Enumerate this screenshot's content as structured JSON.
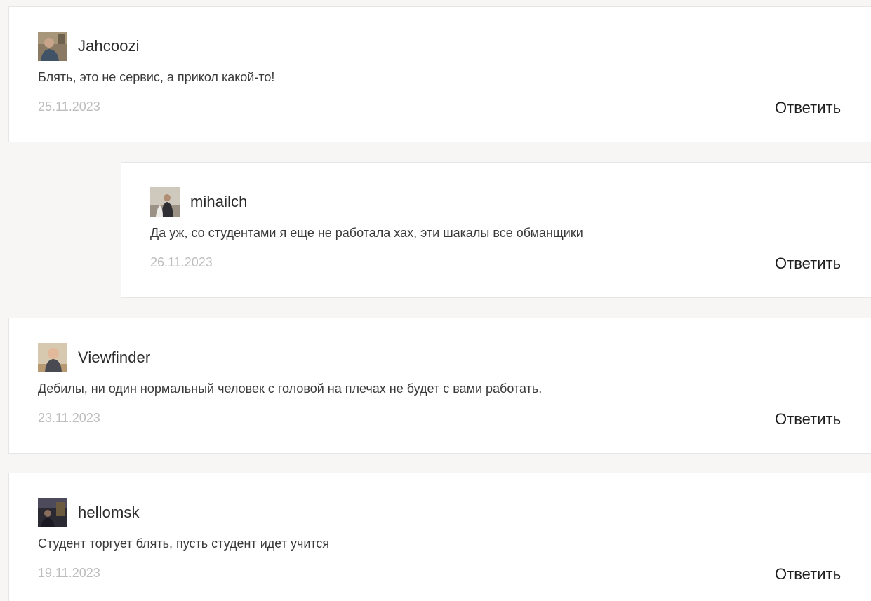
{
  "reply_label": "Ответить",
  "comments": [
    {
      "username": "Jahcoozi",
      "avatar_icon": "user-photo-icon",
      "text": "Блять, это не сервис, а прикол какой-то!",
      "date": "25.11.2023",
      "is_reply": false
    },
    {
      "username": "mihailch",
      "avatar_icon": "user-photo-icon",
      "text": "Да уж, со студентами я еще не работала хах, эти шакалы все обманщики",
      "date": "26.11.2023",
      "is_reply": true
    },
    {
      "username": "Viewfinder",
      "avatar_icon": "user-photo-icon",
      "text": "Дебилы, ни один нормальный человек с головой на плечах не будет с вами работать.",
      "date": "23.11.2023",
      "is_reply": false
    },
    {
      "username": "hellomsk",
      "avatar_icon": "user-photo-icon",
      "text": "Студент торгует блять, пусть студент идет учится",
      "date": "19.11.2023",
      "is_reply": false
    }
  ]
}
